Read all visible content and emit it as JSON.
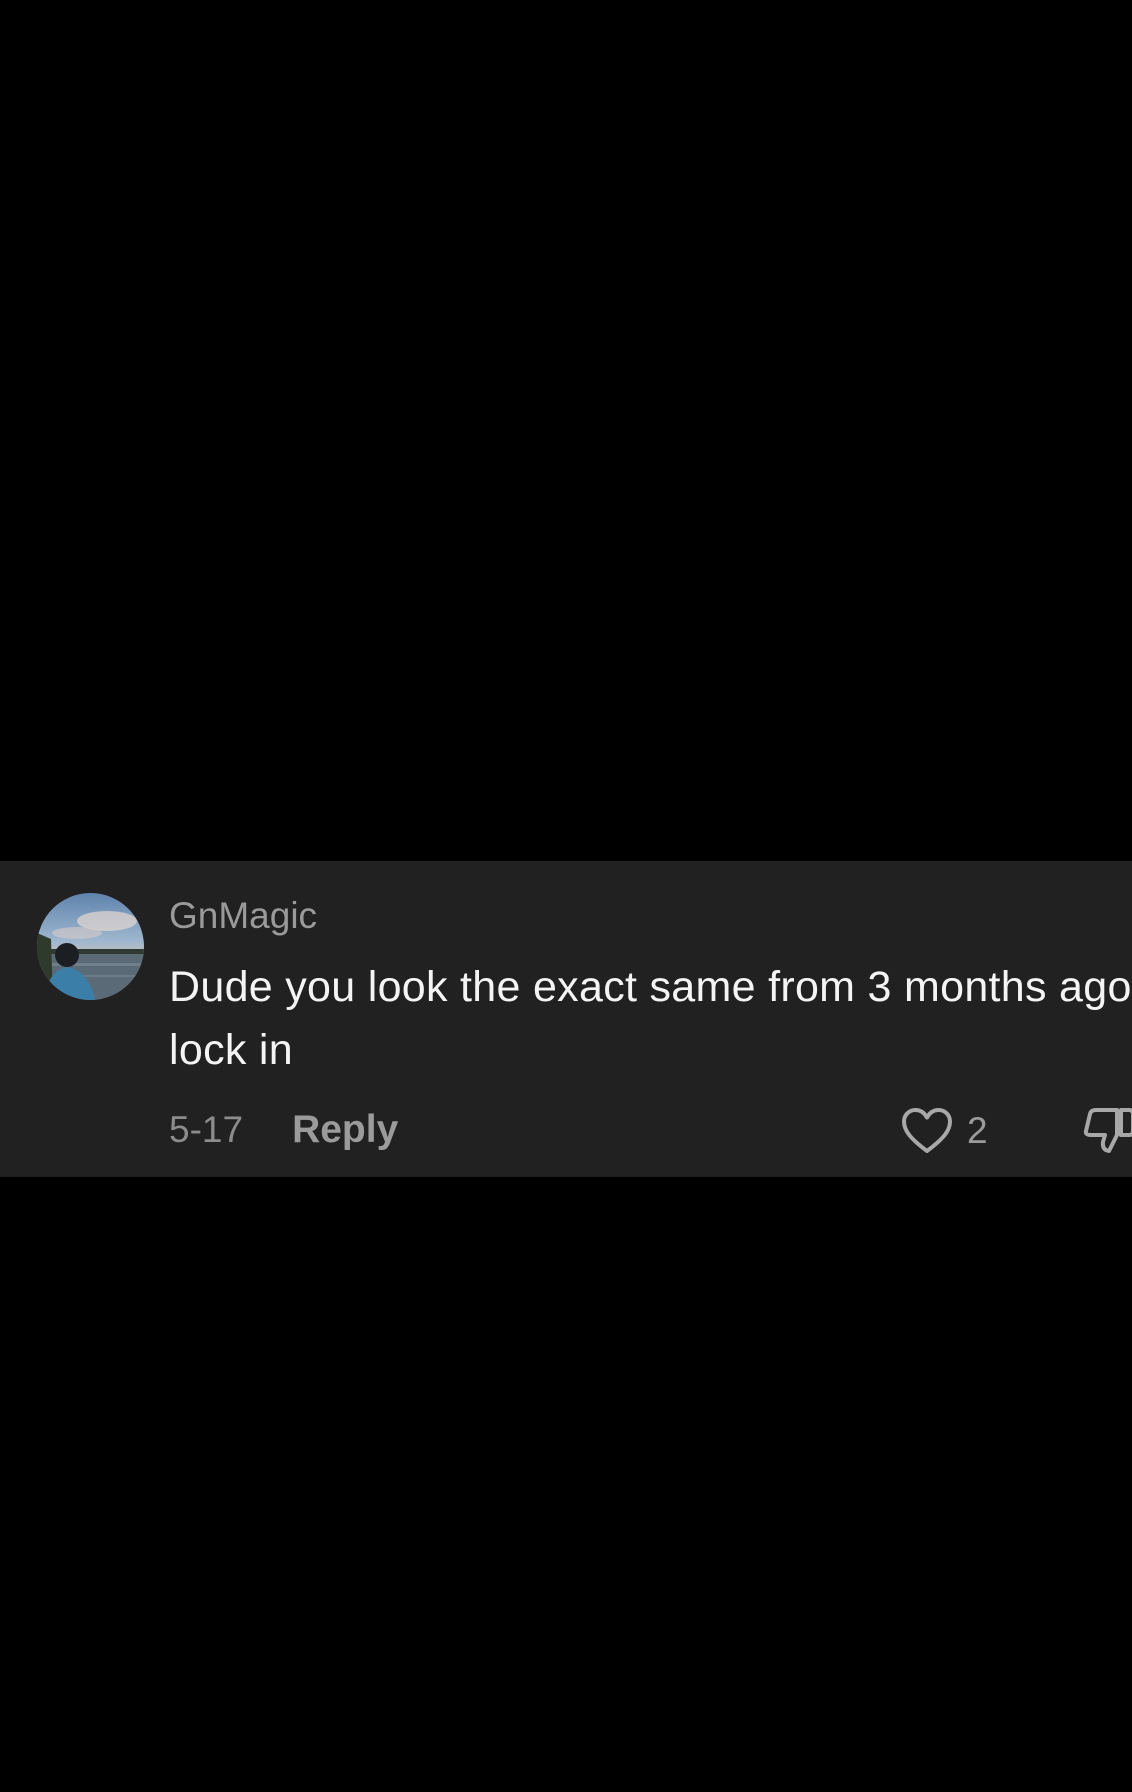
{
  "comment": {
    "username": "GnMagic",
    "text": "Dude you look the exact same from 3 months ago lock in",
    "date": "5-17",
    "reply_label": "Reply",
    "like_count": "2",
    "avatar_icon": "profile-photo-lake-scene",
    "like_icon": "heart-outline-icon",
    "dislike_icon": "thumbs-down-outline-icon"
  },
  "colors": {
    "page_background": "#000000",
    "card_background": "#212121",
    "username": "#9a9a9a",
    "comment_text": "#f4f4f4",
    "secondary_text": "#8c8c8c"
  }
}
